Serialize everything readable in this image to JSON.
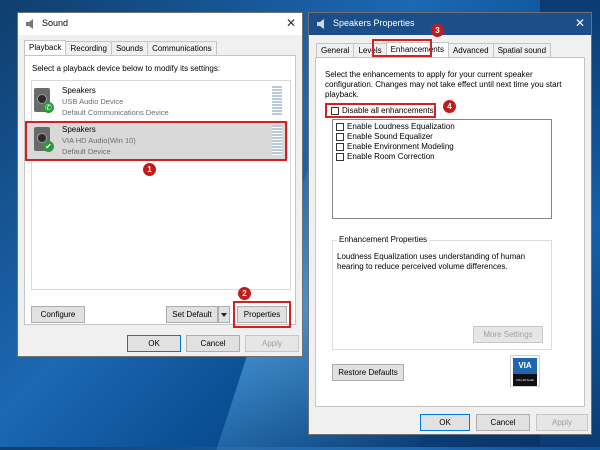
{
  "sound_window": {
    "title": "Sound",
    "close": "✕",
    "tabs": [
      "Playback",
      "Recording",
      "Sounds",
      "Communications"
    ],
    "instruction": "Select a playback device below to modify its settings:",
    "devices": [
      {
        "name": "Speakers",
        "line1": "USB Audio Device",
        "line2": "Default Communications Device",
        "status": "✆"
      },
      {
        "name": "Speakers",
        "line1": "VIA HD Audio(Win 10)",
        "line2": "Default Device",
        "status": "✔"
      }
    ],
    "buttons": {
      "configure": "Configure",
      "set_default": "Set Default",
      "properties": "Properties",
      "ok": "OK",
      "cancel": "Cancel",
      "apply": "Apply"
    }
  },
  "props_window": {
    "title": "Speakers Properties",
    "close": "✕",
    "tabs": [
      "General",
      "Levels",
      "Enhancements",
      "Advanced",
      "Spatial sound"
    ],
    "description": "Select the enhancements to apply for your current speaker configuration. Changes may not take effect until next time you start playback.",
    "disable_all": "Disable all enhancements",
    "enhancements": [
      "Enable Loudness Equalization",
      "Enable Sound Equalizer",
      "Enable Environment Modeling",
      "Enable Room Correction"
    ],
    "group_label": "Enhancement Properties",
    "group_text": "Loudness Equalization uses understanding of human hearing to reduce perceived volume differences.",
    "buttons": {
      "more_settings": "More Settings",
      "restore_defaults": "Restore Defaults",
      "ok": "OK",
      "cancel": "Cancel",
      "apply": "Apply"
    },
    "logo_text": "VIA HD Audio"
  },
  "annotations": [
    "1",
    "2",
    "3",
    "4"
  ],
  "colors": {
    "highlight": "#d42020",
    "accent": "#0078d7",
    "titlebar_active": "#1c4f8a"
  }
}
